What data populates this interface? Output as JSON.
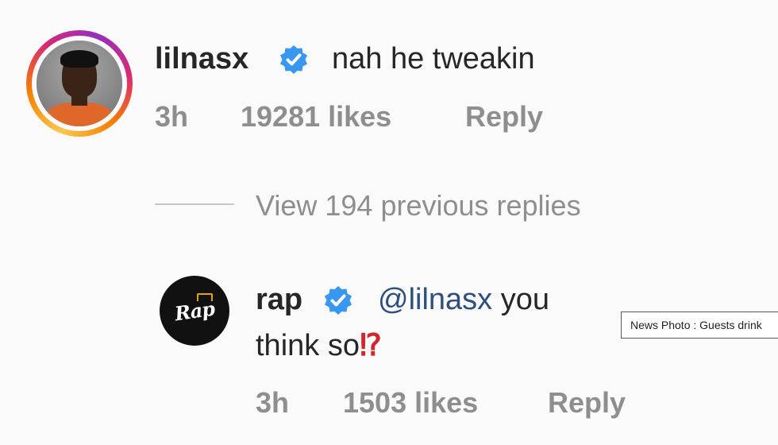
{
  "comment1": {
    "username": "lilnasx",
    "verified": true,
    "text": "nah he tweakin",
    "time": "3h",
    "likes": "19281 likes",
    "reply": "Reply"
  },
  "thread": {
    "view_replies": "View 194 previous replies"
  },
  "comment2": {
    "username": "rap",
    "verified": true,
    "mention": "@lilnasx",
    "text_line1": " you",
    "text_line2": "think so",
    "emoji": "⁉",
    "time": "3h",
    "likes": "1503 likes",
    "reply": "Reply",
    "avatar_logo_text": "Rap"
  },
  "overlay": {
    "caption": "News Photo : Guests drink"
  },
  "colors": {
    "background": "#fafafa",
    "text": "#262626",
    "muted": "#8e8e8e",
    "verified_blue": "#3897f0",
    "mention": "#2d4f7d"
  }
}
